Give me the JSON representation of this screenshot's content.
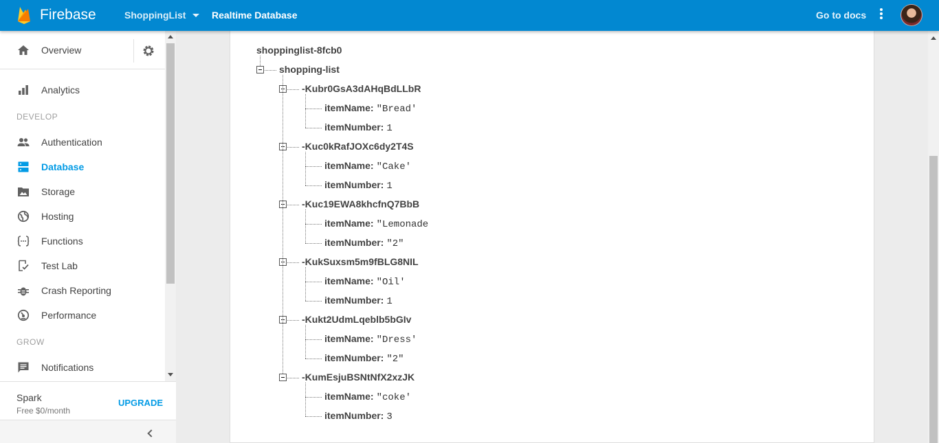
{
  "topbar": {
    "brand": "Firebase",
    "project": "ShoppingList",
    "page_title": "Realtime Database",
    "docs_link": "Go to docs",
    "brand_color": "#0288d1"
  },
  "sidebar": {
    "overview": "Overview",
    "analytics": "Analytics",
    "develop_heading": "DEVELOP",
    "develop_items": [
      "Authentication",
      "Database",
      "Storage",
      "Hosting",
      "Functions",
      "Test Lab",
      "Crash Reporting",
      "Performance"
    ],
    "grow_heading": "GROW",
    "notifications": "Notifications",
    "active_item": "Database",
    "plan": "Spark",
    "plan_price": "Free $0/month",
    "upgrade": "UPGRADE"
  },
  "database": {
    "root": "shoppinglist-8fcb0",
    "list_key": "shopping-list",
    "items": [
      {
        "key": "-Kubr0GsA3dAHqBdLLbR",
        "itemName": "\"Bread'",
        "itemNumber": "1"
      },
      {
        "key": "-Kuc0kRafJOXc6dy2T4S",
        "itemName": "\"Cake'",
        "itemNumber": "1"
      },
      {
        "key": "-Kuc19EWA8khcfnQ7BbB",
        "itemName": "\"Lemonade",
        "itemNumber": "\"2\""
      },
      {
        "key": "-KukSuxsm5m9fBLG8NIL",
        "itemName": "\"Oil'",
        "itemNumber": "1"
      },
      {
        "key": "-Kukt2UdmLqeblb5bGIv",
        "itemName": "\"Dress'",
        "itemNumber": "\"2\""
      },
      {
        "key": "-KumEsjuBSNtNfX2xzJK",
        "itemName": "\"coke'",
        "itemNumber": "3"
      }
    ],
    "field_name_label": "itemName:",
    "field_number_label": "itemNumber:"
  }
}
